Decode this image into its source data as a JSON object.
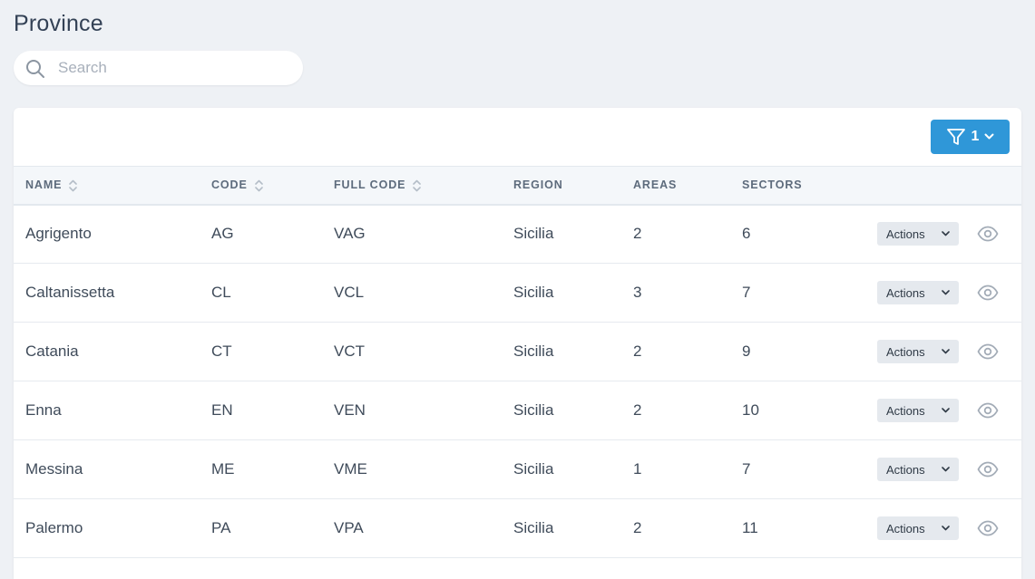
{
  "page": {
    "title": "Province"
  },
  "search": {
    "placeholder": "Search"
  },
  "filter": {
    "count": "1"
  },
  "table": {
    "columns": [
      "Name",
      "Code",
      "Full Code",
      "Region",
      "Areas",
      "Sectors"
    ],
    "rows": [
      {
        "name": "Agrigento",
        "code": "AG",
        "full_code": "VAG",
        "region": "Sicilia",
        "areas": "2",
        "sectors": "6"
      },
      {
        "name": "Caltanissetta",
        "code": "CL",
        "full_code": "VCL",
        "region": "Sicilia",
        "areas": "3",
        "sectors": "7"
      },
      {
        "name": "Catania",
        "code": "CT",
        "full_code": "VCT",
        "region": "Sicilia",
        "areas": "2",
        "sectors": "9"
      },
      {
        "name": "Enna",
        "code": "EN",
        "full_code": "VEN",
        "region": "Sicilia",
        "areas": "2",
        "sectors": "10"
      },
      {
        "name": "Messina",
        "code": "ME",
        "full_code": "VME",
        "region": "Sicilia",
        "areas": "1",
        "sectors": "7"
      },
      {
        "name": "Palermo",
        "code": "PA",
        "full_code": "VPA",
        "region": "Sicilia",
        "areas": "2",
        "sectors": "11"
      }
    ],
    "actions_label": "Actions"
  },
  "colors": {
    "primary": "#2f97d8",
    "background": "#eef1f5",
    "header_bg": "#f4f7fa"
  }
}
